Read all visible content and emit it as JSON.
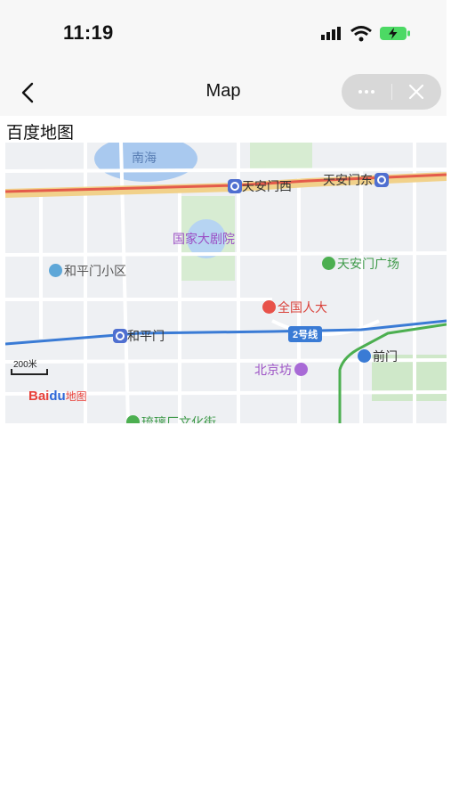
{
  "status_bar": {
    "time": "11:19"
  },
  "nav": {
    "title": "Map"
  },
  "heading": "百度地图",
  "map": {
    "labels": {
      "nanhai": "南海",
      "tiananmen_xi": "天安门西",
      "tiananmen_dong": "天安门东",
      "grand_theatre": "国家大剧院",
      "tiananmen_square": "天安门广场",
      "hepingmen_district": "和平门小区",
      "npc": "全国人大",
      "hepingmen": "和平门",
      "line2": "2号线",
      "beijingfang": "北京坊",
      "qianmen": "前门",
      "bottom_partial": "琉璃厂文化街"
    },
    "scale": "200米",
    "logo": {
      "bai": "Bai",
      "du": "du",
      "map": "地图"
    }
  },
  "colors": {
    "road_major": "#e6b84a",
    "road_red": "#e45b4b",
    "metro_blue": "#3a7bd5",
    "metro_green": "#4caf50",
    "water": "#a9c9ef",
    "park": "#cfe8c9"
  }
}
